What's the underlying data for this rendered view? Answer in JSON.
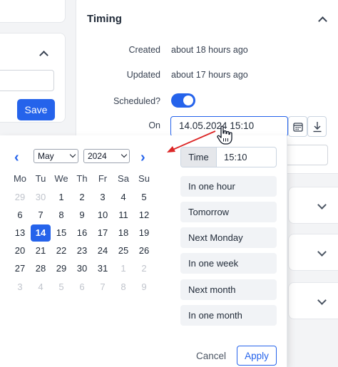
{
  "left_panel": {
    "save_label": "Save"
  },
  "timing": {
    "title": "Timing",
    "created_label": "Created",
    "created_value": "about 18 hours ago",
    "updated_label": "Updated",
    "updated_value": "about 17 hours ago",
    "scheduled_label": "Scheduled?",
    "scheduled_on": true,
    "on_label": "On",
    "date_value": "14.05.2024 15:10"
  },
  "calendar": {
    "month": "May",
    "year": "2024",
    "weekdays": [
      "Mo",
      "Tu",
      "We",
      "Th",
      "Fr",
      "Sa",
      "Su"
    ],
    "weeks": [
      [
        "29",
        "30",
        "1",
        "2",
        "3",
        "4",
        "5"
      ],
      [
        "6",
        "7",
        "8",
        "9",
        "10",
        "11",
        "12"
      ],
      [
        "13",
        "14",
        "15",
        "16",
        "17",
        "18",
        "19"
      ],
      [
        "20",
        "21",
        "22",
        "23",
        "24",
        "25",
        "26"
      ],
      [
        "27",
        "28",
        "29",
        "30",
        "31",
        "1",
        "2"
      ],
      [
        "3",
        "4",
        "5",
        "6",
        "7",
        "8",
        "9"
      ]
    ],
    "selected_day": "14",
    "time_label": "Time",
    "time_value": "15:10",
    "quick_options": [
      "In one hour",
      "Tomorrow",
      "Next Monday",
      "In one week",
      "Next month",
      "In one month"
    ],
    "cancel_label": "Cancel",
    "apply_label": "Apply"
  },
  "colors": {
    "accent": "#2563eb",
    "annotation_arrow": "#dc2626"
  }
}
